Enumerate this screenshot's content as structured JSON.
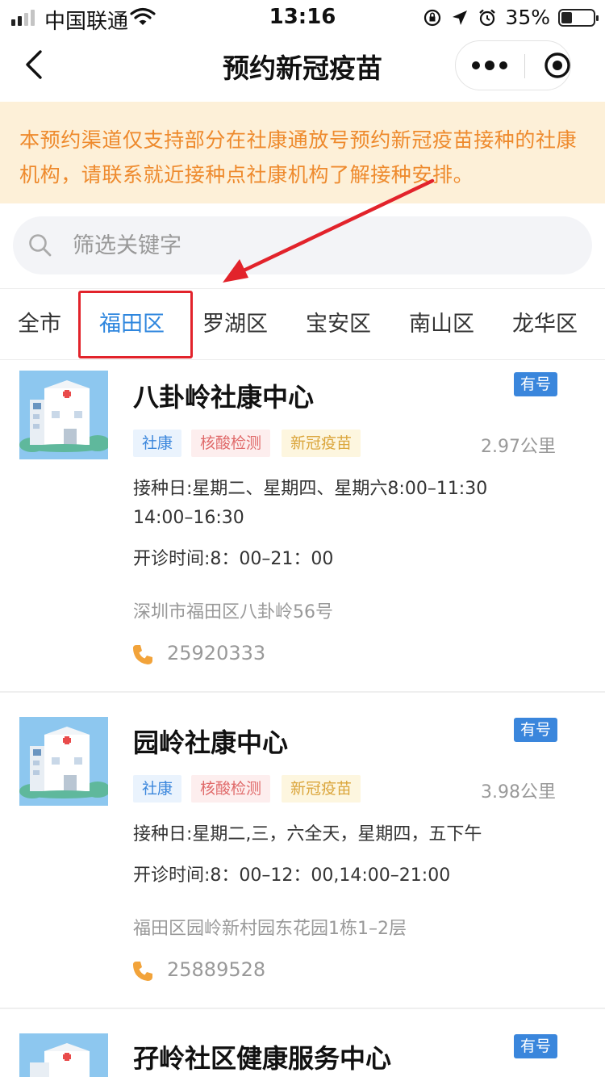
{
  "status_bar": {
    "carrier": "中国联通",
    "time": "13:16",
    "battery_percent": "35%",
    "battery_level": 0.35
  },
  "nav": {
    "title": "预约新冠疫苗",
    "icons": [
      "back-icon",
      "more-dots-icon",
      "close-target-icon"
    ]
  },
  "notice": {
    "text": "本预约渠道仅支持部分在社康通放号预约新冠疫苗接种的社康机构，请联系就近接种点社康机构了解接种安排。"
  },
  "search": {
    "placeholder": "筛选关键字",
    "value": ""
  },
  "tabs": [
    {
      "label": "全市",
      "active": false
    },
    {
      "label": "福田区",
      "active": true
    },
    {
      "label": "罗湖区",
      "active": false
    },
    {
      "label": "宝安区",
      "active": false
    },
    {
      "label": "南山区",
      "active": false
    },
    {
      "label": "龙华区",
      "active": false
    }
  ],
  "clinics": [
    {
      "name": "八卦岭社康中心",
      "badge": "有号",
      "tags": [
        "社康",
        "核酸检测",
        "新冠疫苗"
      ],
      "distance": "2.97公里",
      "schedule": "接种日:星期二、星期四、星期六8:00–11:30 14:00–16:30",
      "hours": "开诊时间:8：00–21：00",
      "address": "深圳市福田区八卦岭56号",
      "phone": "25920333"
    },
    {
      "name": "园岭社康中心",
      "badge": "有号",
      "tags": [
        "社康",
        "核酸检测",
        "新冠疫苗"
      ],
      "distance": "3.98公里",
      "schedule": "接种日:星期二,三，六全天，星期四，五下午",
      "hours": "开诊时间:8：00–12：00,14:00–21:00",
      "address": "福田区园岭新村园东花园1栋1–2层",
      "phone": "25889528"
    },
    {
      "name": "孖岭社区健康服务中心",
      "badge": "有号"
    }
  ],
  "colors": {
    "accent": "#2e86de",
    "badge": "#3a86dc",
    "notice_text": "#ee8a2d",
    "notice_bg": "#fdf0d8",
    "highlight": "#e2232b"
  }
}
